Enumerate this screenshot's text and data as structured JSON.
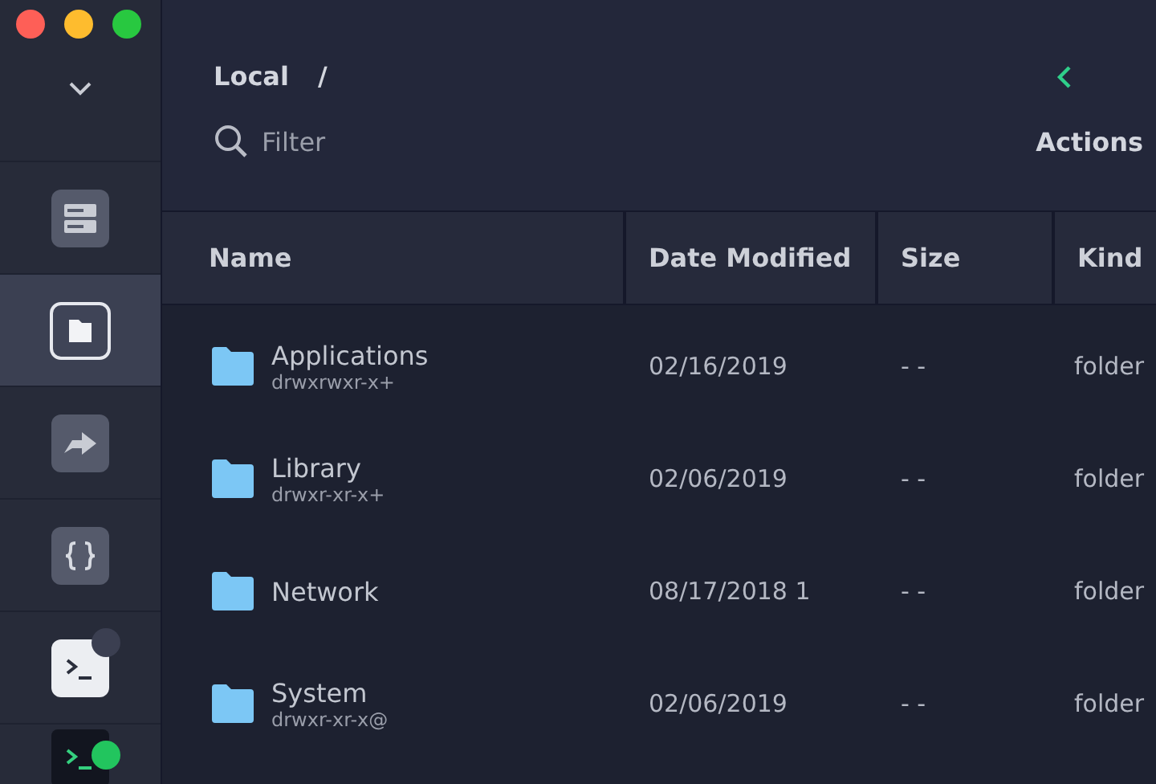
{
  "sidebar": {
    "items": [
      {
        "selected": false
      },
      {
        "selected": true
      },
      {
        "selected": false
      },
      {
        "selected": false
      },
      {
        "selected": false,
        "color": "#3b3f51"
      },
      {
        "selected": false,
        "color": "#22c55e"
      }
    ]
  },
  "breadcrumb": [
    "Local",
    "/"
  ],
  "filter": {
    "placeholder": "Filter"
  },
  "actions": "Actions",
  "table": {
    "columns": [
      "Name",
      "Date Modified",
      "Size",
      "Kind"
    ],
    "rows": [
      {
        "name": "Applications",
        "permissions": "drwxrwxr-x+",
        "date": "02/16/2019",
        "size": "- -",
        "kind": "folder"
      },
      {
        "name": "Library",
        "permissions": "drwxr-xr-x+",
        "date": "02/06/2019",
        "size": "- -",
        "kind": "folder"
      },
      {
        "name": "Network",
        "date": "08/17/2018 1",
        "size": "- -",
        "kind": "folder"
      },
      {
        "name": "System",
        "permissions": "drwxr-xr-x@",
        "date": "02/06/2019",
        "size": "- -",
        "kind": "folder"
      }
    ]
  }
}
